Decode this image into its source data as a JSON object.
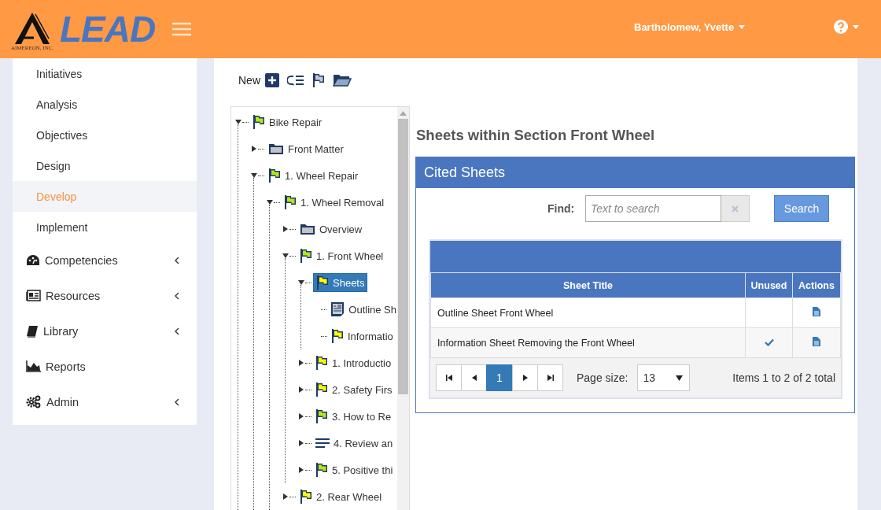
{
  "header": {
    "logo_caption": "AIMEREON, INC.",
    "logo_text": "LEAD",
    "user": "Bartholomew, Yvette"
  },
  "sidebar": {
    "subitems": [
      {
        "label": "Initiatives",
        "selected": false
      },
      {
        "label": "Analysis",
        "selected": false
      },
      {
        "label": "Objectives",
        "selected": false
      },
      {
        "label": "Design",
        "selected": false
      },
      {
        "label": "Develop",
        "selected": true
      },
      {
        "label": "Implement",
        "selected": false
      }
    ],
    "items": [
      {
        "label": "Competencies",
        "collapsible": true
      },
      {
        "label": "Resources",
        "collapsible": true
      },
      {
        "label": "Library",
        "collapsible": true
      },
      {
        "label": "Reports",
        "collapsible": false
      },
      {
        "label": "Admin",
        "collapsible": true
      }
    ]
  },
  "toolbar": {
    "new_label": "New"
  },
  "tree": [
    {
      "label": "Bike Repair",
      "kind": "flag",
      "color": "#b5e61d",
      "selected": false,
      "expanded": true,
      "children": [
        {
          "label": "Front Matter",
          "kind": "folder",
          "selected": false,
          "expanded": false
        },
        {
          "label": "1. Wheel Repair",
          "kind": "flag",
          "color": "#b5e61d",
          "selected": false,
          "expanded": true,
          "children": [
            {
              "label": "1. Wheel Removal",
              "kind": "flag",
              "color": "#b5e61d",
              "selected": false,
              "expanded": true,
              "children": [
                {
                  "label": "Overview",
                  "kind": "folder",
                  "selected": false,
                  "expanded": false
                },
                {
                  "label": "1. Front Wheel",
                  "kind": "flag",
                  "color": "#b5e61d",
                  "selected": false,
                  "expanded": true,
                  "children": [
                    {
                      "label": "Sheets",
                      "kind": "flag",
                      "color": "#ffff00",
                      "selected": true,
                      "expanded": true,
                      "children": [
                        {
                          "label": "Outline Sh",
                          "kind": "sheet",
                          "selected": false
                        },
                        {
                          "label": "Informatio",
                          "kind": "flag",
                          "color": "#ffff00",
                          "selected": false
                        }
                      ]
                    },
                    {
                      "label": "1. Introductio",
                      "kind": "flag",
                      "color": "#ffff00",
                      "selected": false,
                      "expanded": false
                    },
                    {
                      "label": "2. Safety Firs",
                      "kind": "flag",
                      "color": "#ffff00",
                      "selected": false,
                      "expanded": false
                    },
                    {
                      "label": "3. How to Re",
                      "kind": "flag",
                      "color": "#b5e61d",
                      "selected": false,
                      "expanded": false
                    },
                    {
                      "label": "4. Review an",
                      "kind": "lines",
                      "selected": false,
                      "expanded": false
                    },
                    {
                      "label": "5. Positive thi",
                      "kind": "flag",
                      "color": "#b5e61d",
                      "selected": false,
                      "expanded": false
                    }
                  ]
                },
                {
                  "label": "2. Rear Wheel",
                  "kind": "flag",
                  "color": "#ffff00",
                  "selected": false,
                  "expanded": false
                }
              ]
            }
          ]
        }
      ]
    }
  ],
  "section_title": "Sheets within Section Front Wheel",
  "panel": {
    "title": "Cited Sheets",
    "find_label": "Find:",
    "search_placeholder": "Text to search",
    "search_button": "Search",
    "columns": [
      "Sheet Title",
      "Unused",
      "Actions"
    ],
    "rows": [
      {
        "title": "Outline Sheet Front Wheel",
        "unused": false
      },
      {
        "title": "Information Sheet Removing the Front Wheel",
        "unused": true
      }
    ],
    "pages": [
      {
        "label": "1",
        "selected": true
      }
    ],
    "page_size_label": "Page size:",
    "page_size": "13",
    "summary": "Items 1 to 2 of 2 total"
  }
}
